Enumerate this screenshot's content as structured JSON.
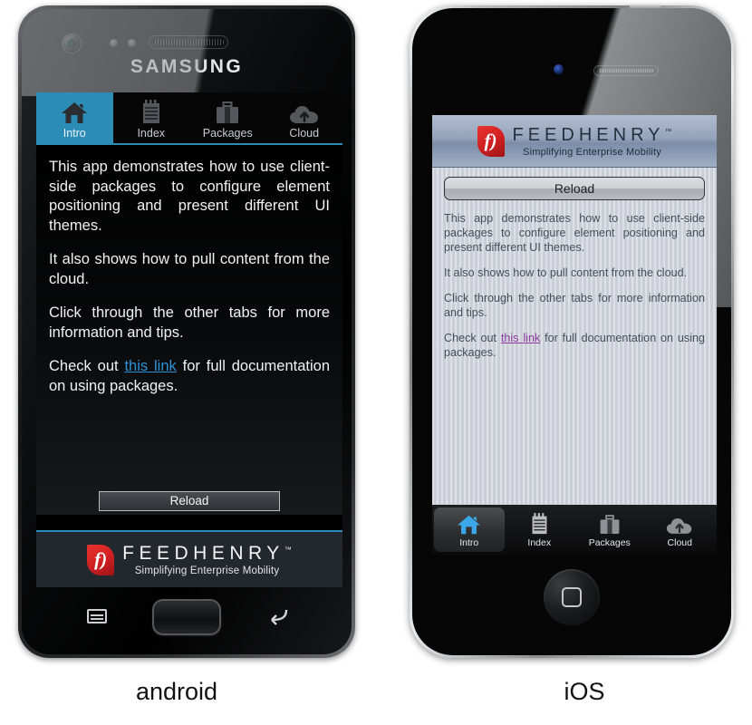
{
  "captions": {
    "android": "android",
    "ios": "iOS"
  },
  "brand": {
    "device_android": "SAMSUNG",
    "name": "FEEDHENRY",
    "tm": "™",
    "tagline": "Simplifying Enterprise Mobility",
    "mark_glyph": "f)",
    "mark_color": "#d32023",
    "accent_android": "#2b8cb5",
    "accent_ios": "#3ba7e8"
  },
  "android": {
    "tabs": [
      {
        "label": "Intro",
        "icon": "home-icon",
        "active": true
      },
      {
        "label": "Index",
        "icon": "list-icon",
        "active": false
      },
      {
        "label": "Packages",
        "icon": "briefcase-icon",
        "active": false
      },
      {
        "label": "Cloud",
        "icon": "cloud-upload-icon",
        "active": false
      }
    ],
    "paragraphs": [
      "This app demonstrates how to use client-side packages to configure element positioning and present different UI themes.",
      "It also shows how to pull content from the cloud.",
      "Click through the other tabs for more information and tips."
    ],
    "link_paragraph": {
      "before": "Check out ",
      "link": "this link",
      "after": " for full documentation on using packages."
    },
    "reload_label": "Reload",
    "link_color": "#2f93d8"
  },
  "ios": {
    "tabs": [
      {
        "label": "Intro",
        "icon": "home-icon",
        "active": true
      },
      {
        "label": "Index",
        "icon": "list-icon",
        "active": false
      },
      {
        "label": "Packages",
        "icon": "briefcase-icon",
        "active": false
      },
      {
        "label": "Cloud",
        "icon": "cloud-upload-icon",
        "active": false
      }
    ],
    "paragraphs": [
      "This app demonstrates how to use client-side packages to configure element positioning and present different UI themes.",
      "It also shows how to pull content from the cloud.",
      "Click through the other tabs for more information and tips."
    ],
    "link_paragraph": {
      "before": "Check out ",
      "link": "this link",
      "after": " for full documentation on using packages."
    },
    "reload_label": "Reload",
    "link_color": "#8b3a9e"
  }
}
